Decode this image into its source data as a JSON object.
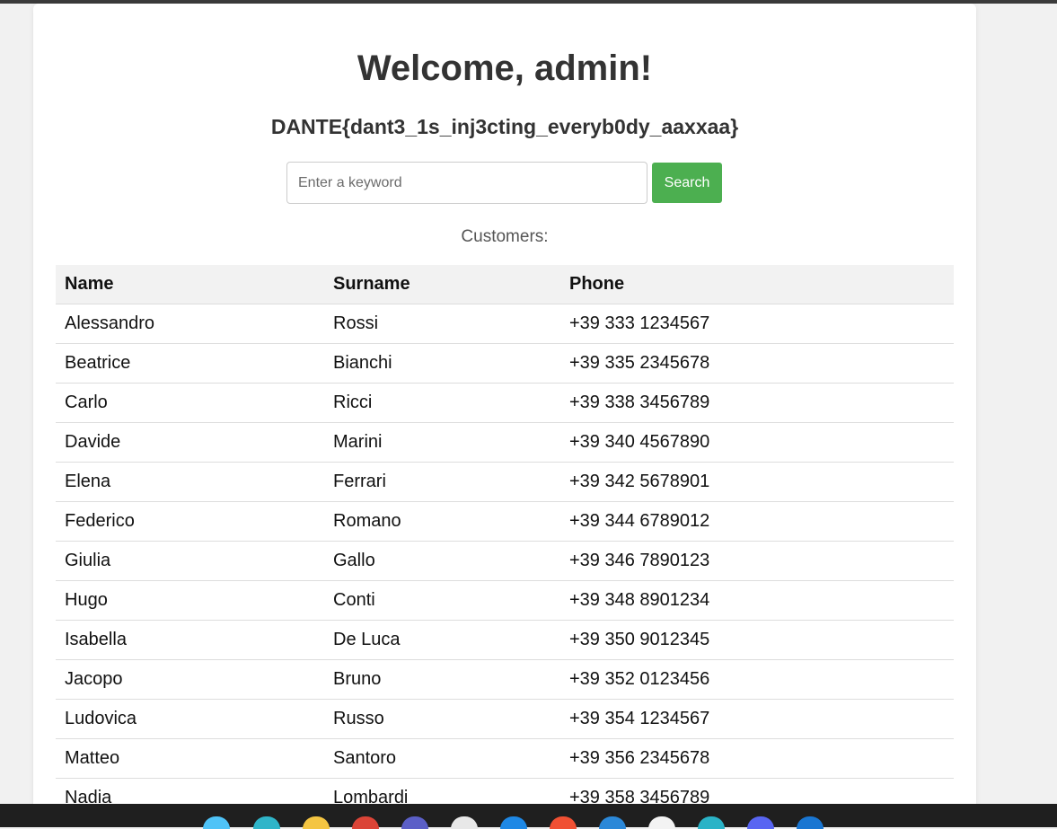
{
  "page": {
    "title": "Welcome, admin!",
    "flag": "DANTE{dant3_1s_inj3cting_everyb0dy_aaxxaa}"
  },
  "search": {
    "placeholder": "Enter a keyword",
    "value": "",
    "button_label": "Search"
  },
  "customers": {
    "label": "Customers:",
    "columns": [
      "Name",
      "Surname",
      "Phone"
    ],
    "rows": [
      [
        "Alessandro",
        "Rossi",
        "+39 333 1234567"
      ],
      [
        "Beatrice",
        "Bianchi",
        "+39 335 2345678"
      ],
      [
        "Carlo",
        "Ricci",
        "+39 338 3456789"
      ],
      [
        "Davide",
        "Marini",
        "+39 340 4567890"
      ],
      [
        "Elena",
        "Ferrari",
        "+39 342 5678901"
      ],
      [
        "Federico",
        "Romano",
        "+39 344 6789012"
      ],
      [
        "Giulia",
        "Gallo",
        "+39 346 7890123"
      ],
      [
        "Hugo",
        "Conti",
        "+39 348 8901234"
      ],
      [
        "Isabella",
        "De Luca",
        "+39 350 9012345"
      ],
      [
        "Jacopo",
        "Bruno",
        "+39 352 0123456"
      ],
      [
        "Ludovica",
        "Russo",
        "+39 354 1234567"
      ],
      [
        "Matteo",
        "Santoro",
        "+39 356 2345678"
      ],
      [
        "Nadia",
        "Lombardi",
        "+39 358 3456789"
      ]
    ]
  },
  "colors": {
    "accent": "#4caf50",
    "header_bg": "#f2f2f2",
    "text": "#333333"
  },
  "taskbar": {
    "icons": [
      {
        "name": "windows-start-icon",
        "color": "#4fc3f7"
      },
      {
        "name": "edge-browser-icon",
        "color": "#2fb5c9"
      },
      {
        "name": "file-explorer-icon",
        "color": "#f4c542"
      },
      {
        "name": "chrome-icon",
        "color": "#db4437"
      },
      {
        "name": "teams-icon",
        "color": "#5b5fc7"
      },
      {
        "name": "calendar-app-icon",
        "color": "#e8e8e8"
      },
      {
        "name": "vscode-icon",
        "color": "#1e88e5"
      },
      {
        "name": "git-app-icon",
        "color": "#f05033"
      },
      {
        "name": "remote-desktop-icon",
        "color": "#2b88d8"
      },
      {
        "name": "active-app-icon",
        "color": "#f3f3f3"
      },
      {
        "name": "terminal-app-icon",
        "color": "#2ab3c7"
      },
      {
        "name": "discord-icon",
        "color": "#5865f2"
      },
      {
        "name": "browser-app-icon",
        "color": "#1976d2"
      }
    ]
  }
}
